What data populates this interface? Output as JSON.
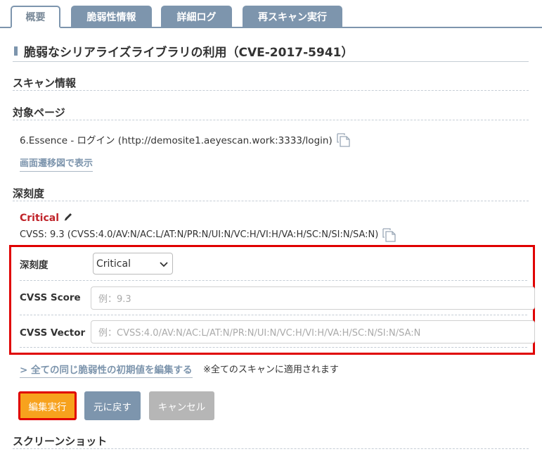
{
  "tabs": [
    {
      "label": "概要",
      "active": true
    },
    {
      "label": "脆弱性情報",
      "active": false
    },
    {
      "label": "詳細ログ",
      "active": false
    },
    {
      "label": "再スキャン実行",
      "active": false
    }
  ],
  "title": "脆弱なシリアライズライブラリの利用（CVE-2017-5941）",
  "sections": {
    "scan_info": "スキャン情報",
    "target_page": "対象ページ",
    "severity": "深刻度",
    "screenshot": "スクリーンショット"
  },
  "target_page_text": "6.Essence - ログイン (http://demosite1.aeyescan.work:3333/login)",
  "transition_link": "画面遷移図で表示",
  "severity_value": "Critical",
  "cvss_text": "CVSS: 9.3 (CVSS:4.0/AV:N/AC:L/AT:N/PR:N/UI:N/VC:H/VI:H/VA:H/SC:N/SI:N/SA:N)",
  "form": {
    "severity_label": "深刻度",
    "severity_selected": "Critical",
    "score_label": "CVSS Score",
    "score_placeholder": "例：9.3",
    "vector_label": "CVSS Vector",
    "vector_placeholder": "例：CVSS:4.0/AV:N/AC:L/AT:N/PR:N/UI:N/VC:H/VI:H/VA:H/SC:N/SI:N/SA:N"
  },
  "edit_all_link": "> 全ての同じ脆弱性の初期値を編集する",
  "edit_all_note": "※全てのスキャンに適用されます",
  "buttons": {
    "execute": "編集実行",
    "revert": "元に戻す",
    "cancel": "キャンセル"
  },
  "colors": {
    "accent": "#7d95ad",
    "critical": "#c0242a",
    "highlight": "#e00000",
    "execute": "#f7a21d"
  }
}
